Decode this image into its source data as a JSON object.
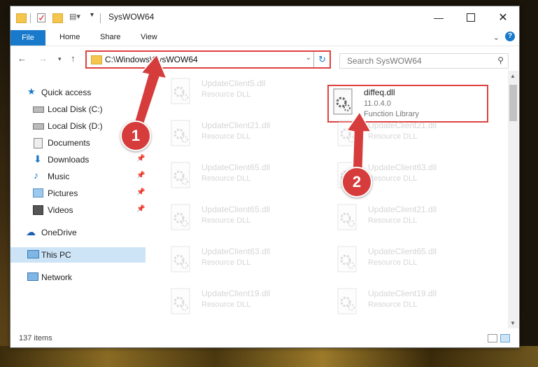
{
  "window": {
    "title": "SysWOW64"
  },
  "ribbon": {
    "tabs": [
      "File",
      "Home",
      "Share",
      "View"
    ]
  },
  "address": {
    "path": "C:\\Windows\\SysWOW64"
  },
  "search": {
    "placeholder": "Search SysWOW64"
  },
  "nav": {
    "items": [
      {
        "label": "Quick access"
      },
      {
        "label": "Local Disk (C:)"
      },
      {
        "label": "Local Disk (D:)"
      },
      {
        "label": "Documents"
      },
      {
        "label": "Downloads"
      },
      {
        "label": "Music"
      },
      {
        "label": "Pictures"
      },
      {
        "label": "Videos"
      },
      {
        "label": "OneDrive"
      },
      {
        "label": "This PC"
      },
      {
        "label": "Network"
      }
    ]
  },
  "files": {
    "left": [
      {
        "name": "UpdateClient5.dll",
        "desc": "Resource DLL"
      },
      {
        "name": "UpdateClient21.dll",
        "desc": "Resource DLL"
      },
      {
        "name": "UpdateClient65.dll",
        "desc": "Resource DLL"
      },
      {
        "name": "UpdateClient65.dll",
        "desc": "Resource DLL"
      },
      {
        "name": "UpdateClient63.dll",
        "desc": "Resource DLL"
      },
      {
        "name": "UpdateClient19.dll",
        "desc": "Resource DLL"
      }
    ],
    "right": [
      {
        "name": "diffeq.dll",
        "version": "11.0.4.0",
        "desc": "Function Library"
      },
      {
        "name": "UpdateClient21.dll",
        "desc": "Resource DLL"
      },
      {
        "name": "UpdateClient63.dll",
        "desc": "Resource DLL"
      },
      {
        "name": "UpdateClient21.dll",
        "desc": "Resource DLL"
      },
      {
        "name": "UpdateClient65.dll",
        "desc": "Resource DLL"
      },
      {
        "name": "UpdateClient19.dll",
        "desc": "Resource DLL"
      }
    ]
  },
  "status": {
    "count": "137 items"
  },
  "callouts": {
    "one": "1",
    "two": "2"
  },
  "colors": {
    "accent": "#1979ca",
    "highlight": "#e04040",
    "callout": "#d63c3c"
  }
}
